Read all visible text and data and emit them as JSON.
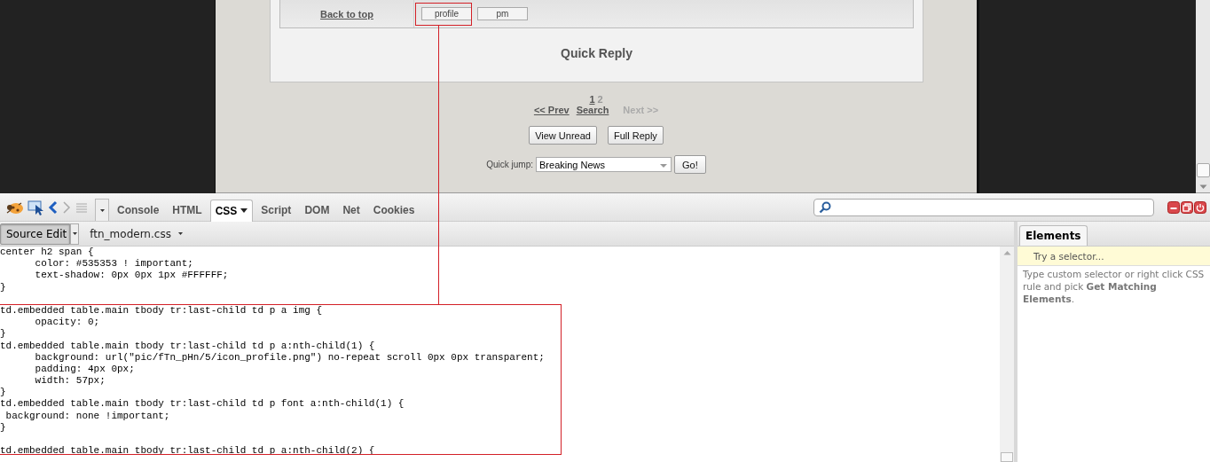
{
  "page": {
    "back_to_top": "Back to top",
    "post_buttons": [
      "profile",
      "pm"
    ],
    "quick_reply": "Quick Reply",
    "pages": [
      {
        "label": "1",
        "selected": true
      },
      {
        "label": "2",
        "selected": false
      }
    ],
    "nav": [
      {
        "label": "<< Prev",
        "disabled": false
      },
      {
        "label": "Search",
        "disabled": false
      },
      {
        "label": "Next >>",
        "disabled": true
      }
    ],
    "buttons": [
      "View Unread",
      "Full Reply"
    ],
    "quick_jump": {
      "label": "Quick jump:",
      "value": "Breaking News",
      "button": "Go!"
    }
  },
  "firebug": {
    "tabs": [
      {
        "label": "Console",
        "selected": false,
        "menu": false
      },
      {
        "label": "HTML",
        "selected": false,
        "menu": false
      },
      {
        "label": "CSS",
        "selected": true,
        "menu": true
      },
      {
        "label": "Script",
        "selected": false,
        "menu": false
      },
      {
        "label": "DOM",
        "selected": false,
        "menu": false
      },
      {
        "label": "Net",
        "selected": false,
        "menu": false
      },
      {
        "label": "Cookies",
        "selected": false,
        "menu": false
      }
    ],
    "source_edit": {
      "label": "Source Edit",
      "pressed": true
    },
    "file": "ftn_modern.css",
    "code_blocks": [
      [
        "center h2 span {",
        "      color: #535353 ! important;",
        "      text-shadow: 0px 0px 1px #FFFFFF;",
        "}"
      ],
      [
        "td.embedded table.main tbody tr:last-child td p a img {",
        "      opacity: 0;",
        "}",
        "td.embedded table.main tbody tr:last-child td p a:nth-child(1) {",
        "      background: url(\"pic/fTn_pHn/5/icon_profile.png\") no-repeat scroll 0px 0px transparent;",
        "      padding: 4px 0px;",
        "      width: 57px;",
        "}",
        "td.embedded table.main tbody tr:last-child td p font a:nth-child(1) {",
        " background: none !important;",
        "}"
      ],
      [
        "td.embedded table.main tbody tr:last-child td p a:nth-child(2) {"
      ]
    ],
    "side_tab": "Elements",
    "selector_placeholder": "Try a selector...",
    "hint": "Type custom selector or right click CSS rule and pick **Get Matching Elements**."
  }
}
